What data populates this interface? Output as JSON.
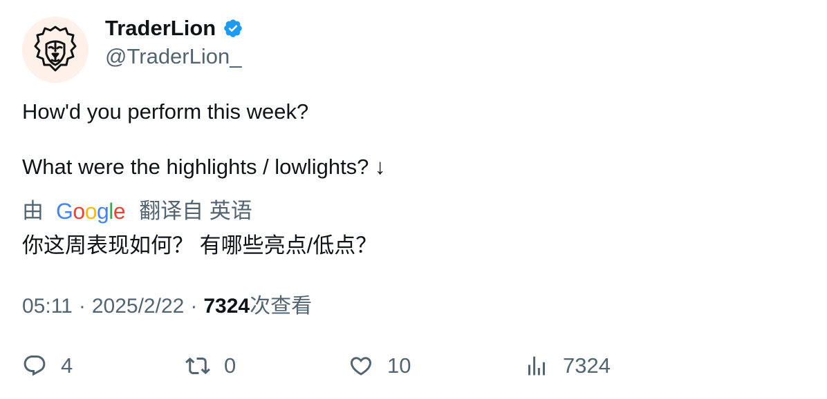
{
  "author": {
    "display_name": "TraderLion",
    "handle": "@TraderLion_",
    "verified": true
  },
  "tweet": {
    "line1": "How'd you perform this week?",
    "line2": "What were the highlights / lowlights? ↓"
  },
  "translation": {
    "by_label": "由",
    "provider": "Google",
    "from_label": "翻译自 英语",
    "text": "你这周表现如何？ 有哪些亮点/低点？"
  },
  "meta": {
    "time": "05:11",
    "date": "2025/2/22",
    "separator": "·",
    "views_count": "7324",
    "views_label": "次查看"
  },
  "actions": {
    "replies": "4",
    "retweets": "0",
    "likes": "10",
    "views": "7324"
  },
  "colors": {
    "text": "#0f1419",
    "muted": "#536471",
    "verified": "#1d9bf0",
    "avatar_bg": "#fdf1ea"
  }
}
